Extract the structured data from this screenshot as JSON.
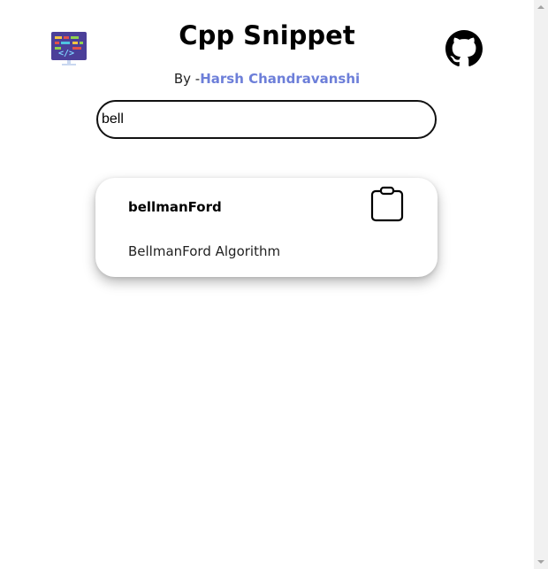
{
  "header": {
    "title": "Cpp Snippet",
    "byline_prefix": "By -",
    "author": "Harsh Chandravanshi"
  },
  "search": {
    "value": "bell"
  },
  "results": [
    {
      "name": "bellmanFord",
      "description": "BellmanFord Algorithm"
    }
  ],
  "icons": {
    "logo": "code-snippet-logo-icon",
    "github": "github-icon",
    "copy": "clipboard-icon"
  },
  "colors": {
    "author_link": "#6d7fd9",
    "logo_bg": "#4b3f99"
  }
}
